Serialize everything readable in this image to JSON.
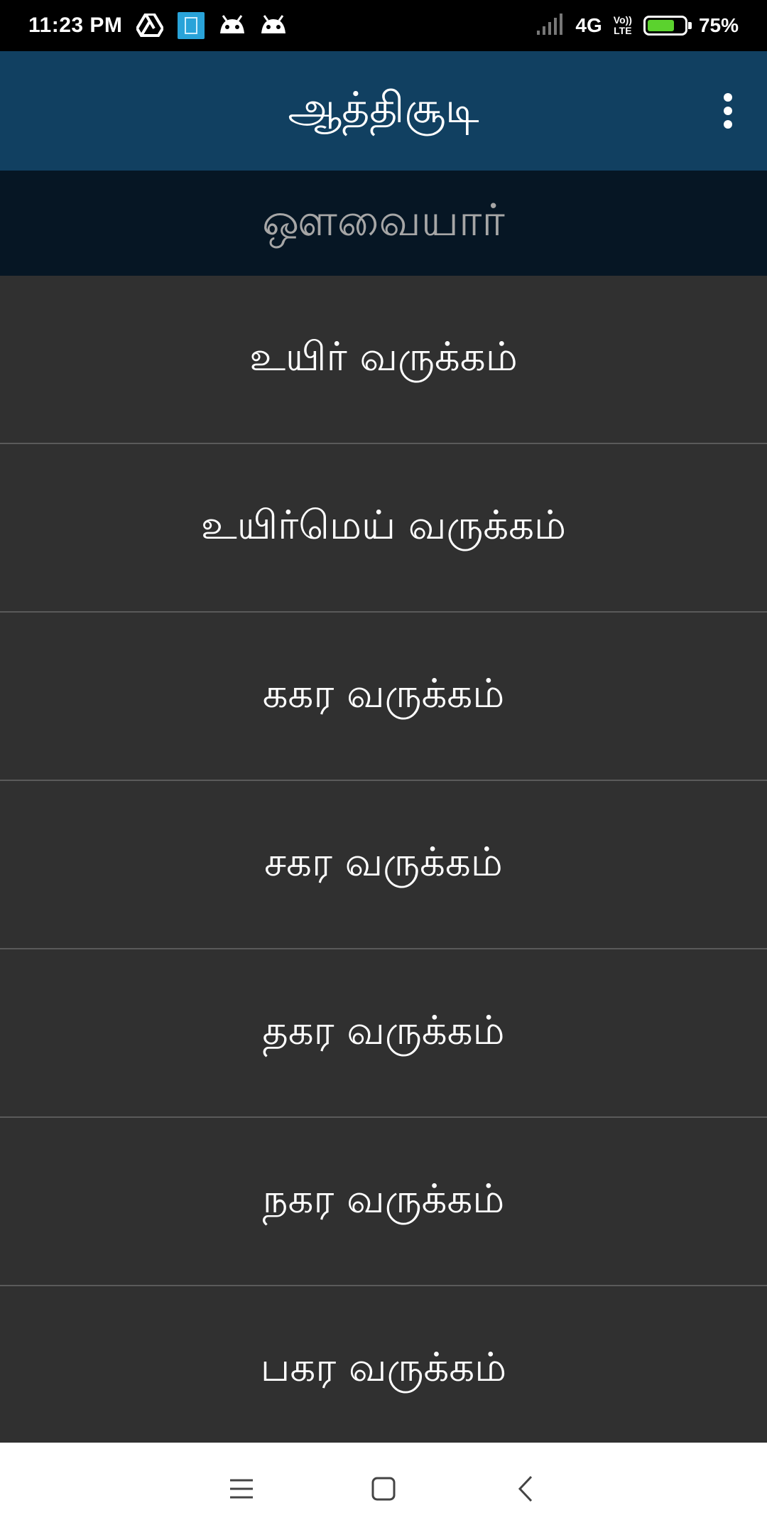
{
  "status_bar": {
    "time": "11:23 PM",
    "network": "4G",
    "volte_top": "Vo))",
    "volte_bottom": "LTE",
    "battery": "75%",
    "battery_level": 0.75,
    "notification_icons": [
      "google-drive-icon",
      "blue-app-icon",
      "android-icon",
      "android-icon"
    ]
  },
  "app_bar": {
    "title": "ஆத்திசூடி",
    "menu_icon": "more-vertical-icon"
  },
  "subtitle": "ஔவையார்",
  "list": {
    "items": [
      "உயிர் வருக்கம்",
      "உயிர்மெய் வருக்கம்",
      "ககர வருக்கம்",
      "சகர வருக்கம்",
      "தகர வருக்கம்",
      "நகர வருக்கம்",
      "பகர வருக்கம்"
    ]
  },
  "nav_bar": {
    "icons": [
      "menu-icon",
      "home-square-icon",
      "back-chevron-icon"
    ]
  },
  "colors": {
    "app_bar": "#114061",
    "subtitle_bar": "#061624",
    "list_bg": "#303030",
    "divider": "#5a5a5a",
    "battery_fill": "#5bd22e"
  }
}
